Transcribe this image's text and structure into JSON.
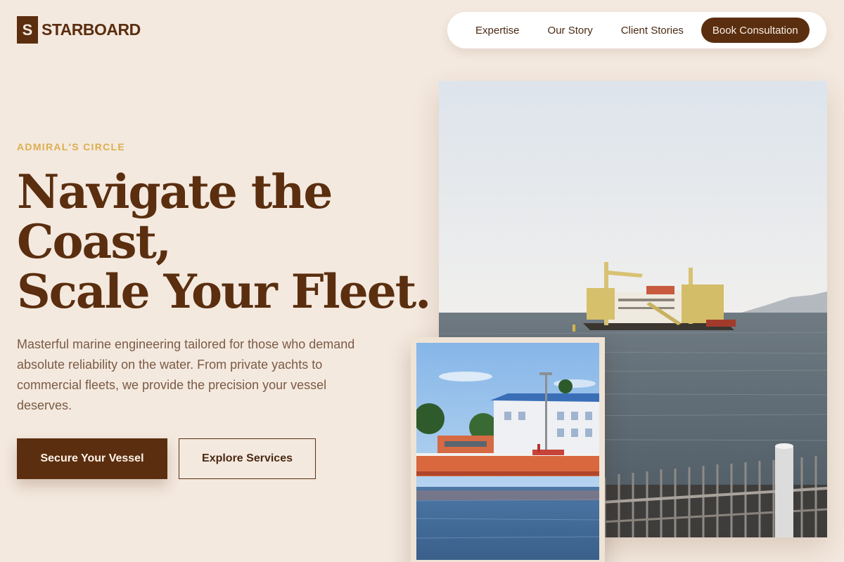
{
  "brand": {
    "mark": "S",
    "name": "STARBOARD"
  },
  "nav": {
    "links": [
      "Expertise",
      "Our Story",
      "Client Stories"
    ],
    "cta": "Book Consultation"
  },
  "hero": {
    "eyebrow": "ADMIRAL'S CIRCLE",
    "headline_lines": [
      "Navigate the",
      "Coast,",
      "Scale Your Fleet."
    ],
    "subtext": "Masterful marine engineering tailored for those who demand absolute reliability on the water. From private yachts to commercial fleets, we provide the precision your vessel deserves.",
    "primary_button": "Secure Your Vessel",
    "secondary_button": "Explore Services"
  },
  "images": {
    "main": "dredging-ship-photo",
    "inset": "orange-workboat-photo"
  },
  "colors": {
    "background": "#f4e9df",
    "brand_brown": "#5a2e0f",
    "eyebrow_gold": "#dcae4f",
    "body_text": "#7a5b45"
  }
}
